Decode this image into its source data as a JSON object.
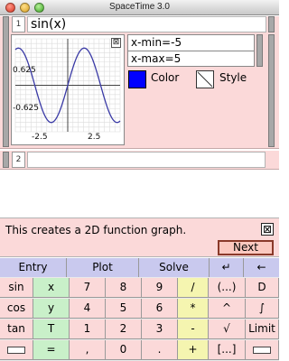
{
  "window": {
    "title": "SpaceTime 3.0"
  },
  "cells": [
    {
      "number": "1",
      "expression": "sin(x)",
      "graph": {
        "close_glyph": "⊠",
        "y_tick_labels": [
          "0.625",
          "-0.625"
        ],
        "x_tick_labels": [
          "-2.5",
          "2.5"
        ]
      },
      "range": {
        "xmin": "x-min=-5",
        "xmax": "x-max=5"
      },
      "color": {
        "label": "Color",
        "value": "#0000ff"
      },
      "style": {
        "label": "Style"
      }
    },
    {
      "number": "2",
      "expression": ""
    }
  ],
  "chart_data": {
    "type": "line",
    "function": "sin(x)",
    "xlim": [
      -5,
      5
    ],
    "x_ticks": [
      -2.5,
      2.5
    ],
    "y_ticks": [
      0.625,
      -0.625
    ],
    "grid": true,
    "series": [
      {
        "color": "#3a3aa6",
        "x": [
          -5,
          -4.5,
          -4,
          -3.5,
          -3,
          -2.5,
          -2,
          -1.5,
          -1,
          -0.5,
          0,
          0.5,
          1,
          1.5,
          2,
          2.5,
          3,
          3.5,
          4,
          4.5,
          5
        ],
        "y": [
          0.959,
          0.978,
          0.757,
          0.351,
          -0.141,
          -0.598,
          -0.909,
          -0.997,
          -0.841,
          -0.479,
          0,
          0.479,
          0.841,
          0.997,
          0.909,
          0.598,
          0.141,
          -0.351,
          -0.757,
          -0.978,
          -0.959
        ]
      }
    ]
  },
  "help": {
    "text": "This creates a 2D function graph.",
    "close_glyph": "⊠",
    "next_label": "Next"
  },
  "keypad": {
    "tabs": [
      "Entry",
      "Plot",
      "Solve",
      "↵",
      "←"
    ],
    "rows": [
      [
        "sin",
        "x",
        "7",
        "8",
        "9",
        "/",
        "(...)",
        "D"
      ],
      [
        "cos",
        "y",
        "4",
        "5",
        "6",
        "*",
        "^",
        "∫"
      ],
      [
        "tan",
        "T",
        "1",
        "2",
        "3",
        "-",
        "√",
        "Limit"
      ],
      [
        "",
        "=",
        ",",
        "0",
        ".",
        "+",
        "[...]",
        ""
      ]
    ]
  }
}
